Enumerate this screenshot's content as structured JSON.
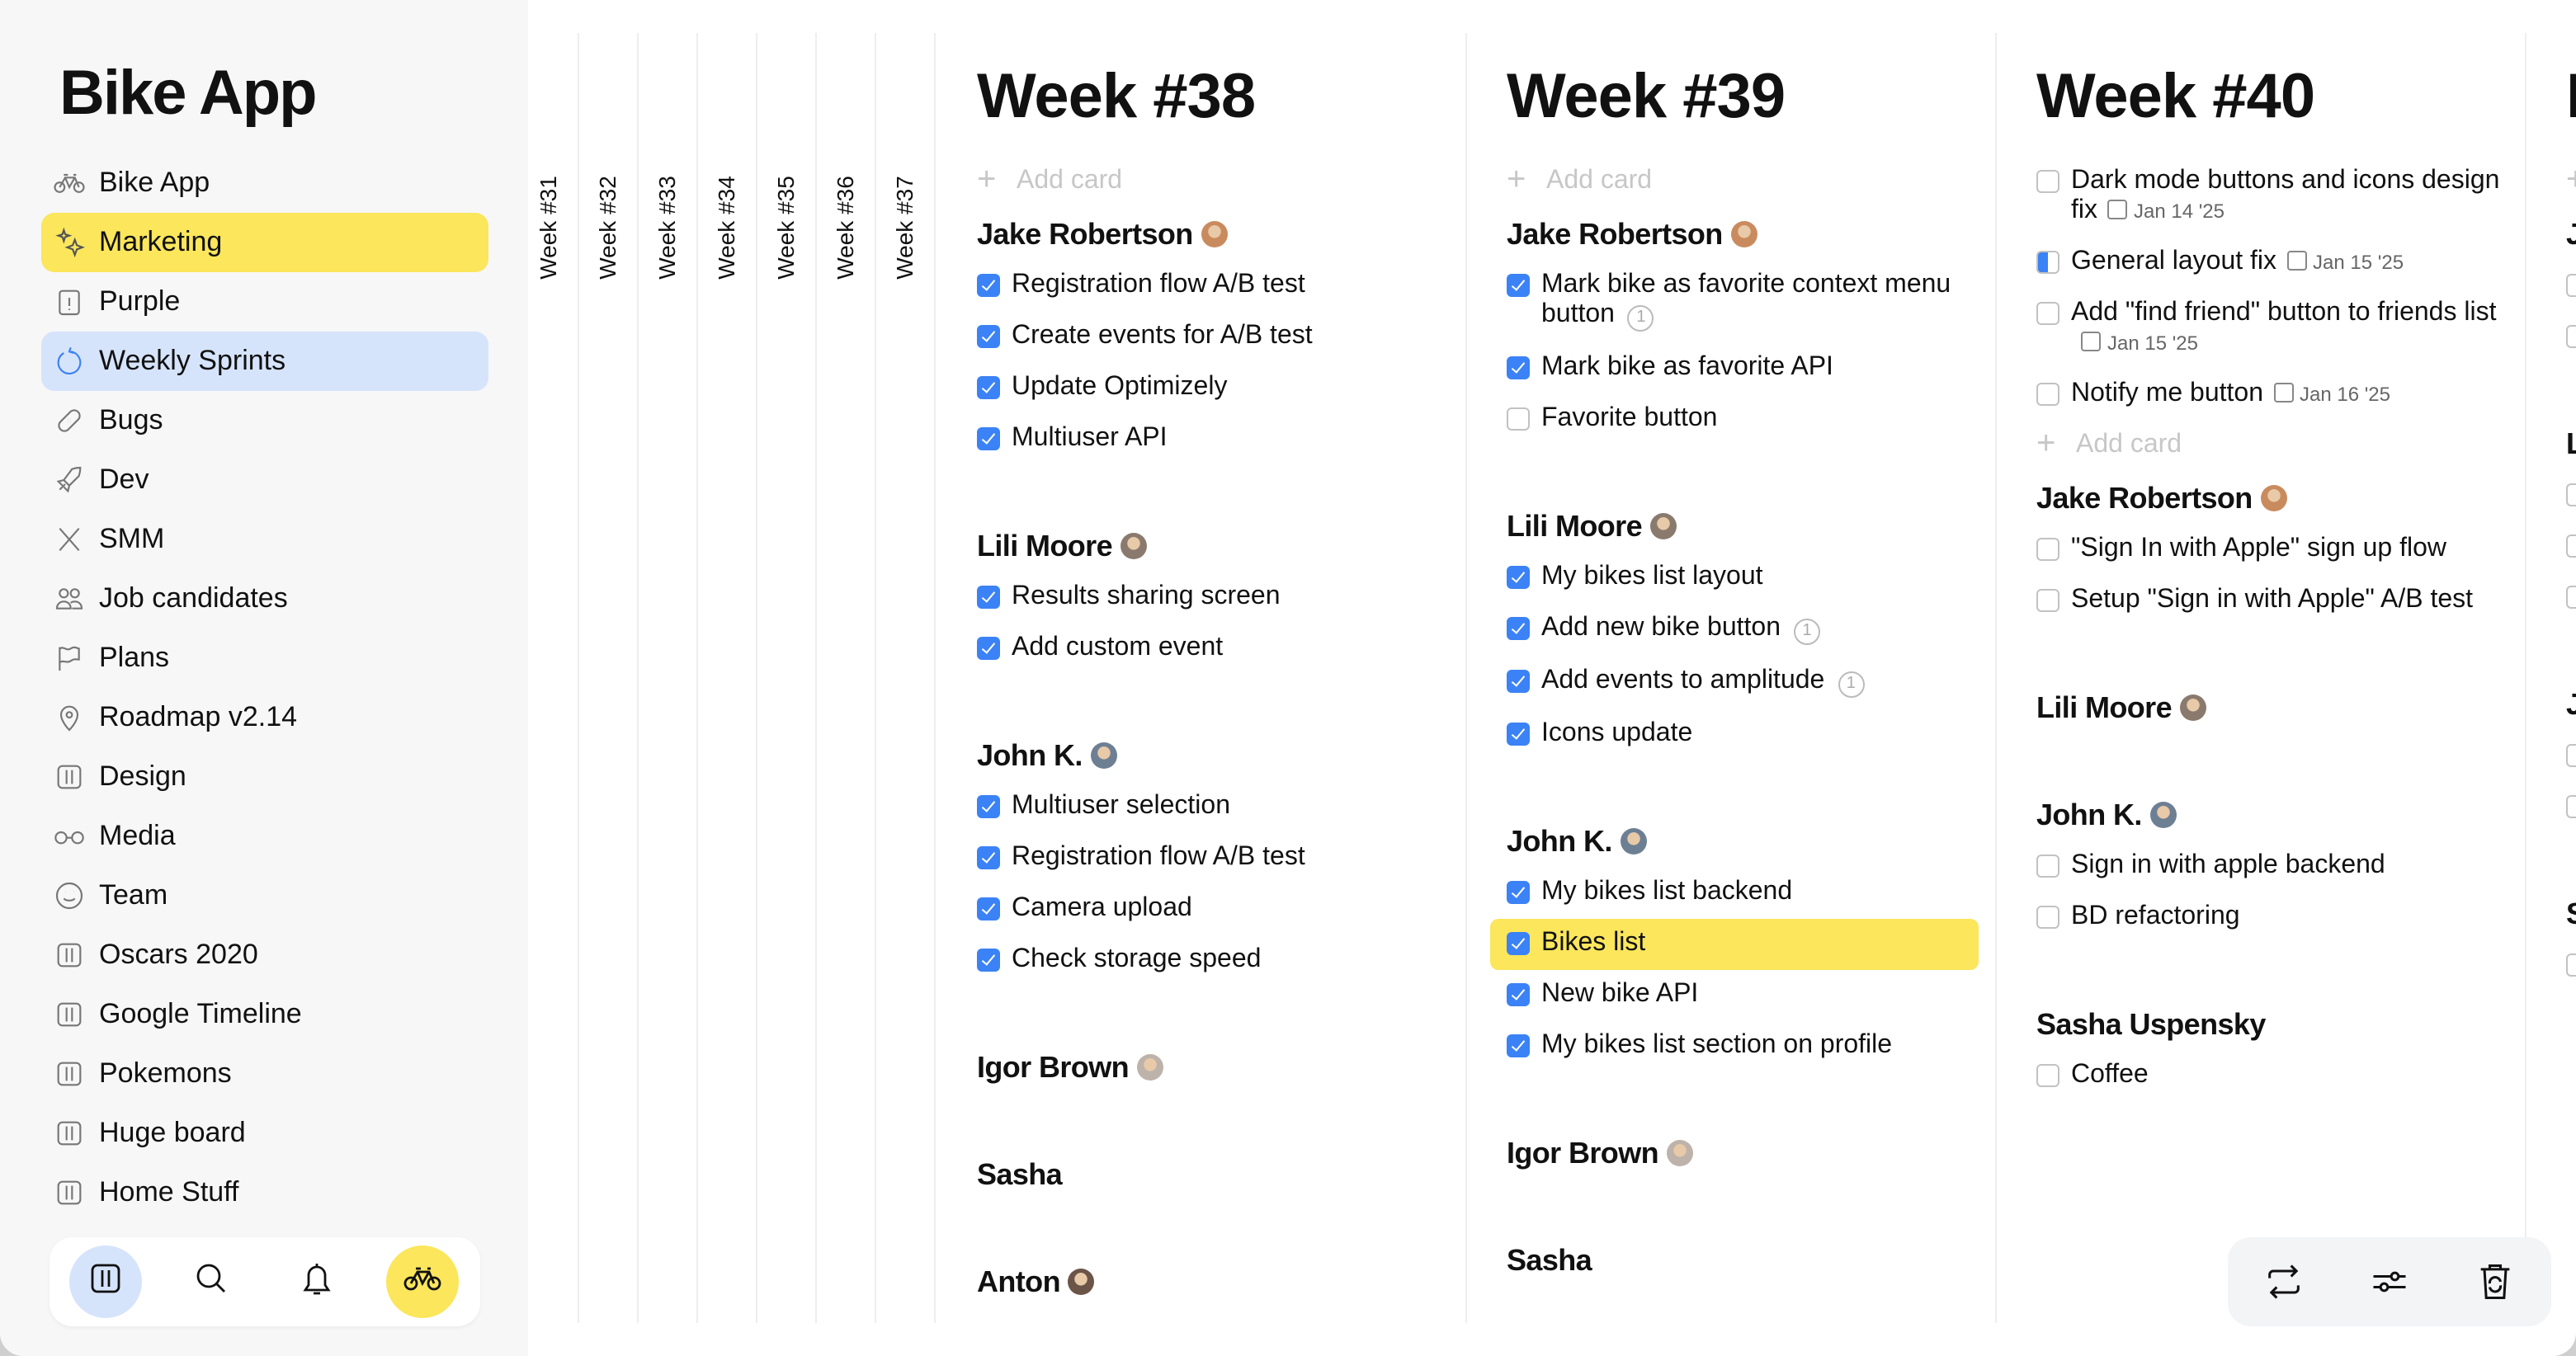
{
  "sidebar": {
    "title": "Bike App",
    "items": [
      {
        "label": "Bike App",
        "icon": "bike-icon",
        "state": ""
      },
      {
        "label": "Marketing",
        "icon": "sparkles-icon",
        "state": "yellow"
      },
      {
        "label": "Purple",
        "icon": "clipboard-alert-icon",
        "state": ""
      },
      {
        "label": "Weekly Sprints",
        "icon": "refresh-icon",
        "state": "blue"
      },
      {
        "label": "Bugs",
        "icon": "bandage-icon",
        "state": ""
      },
      {
        "label": "Dev",
        "icon": "rocket-icon",
        "state": ""
      },
      {
        "label": "SMM",
        "icon": "x-logo-icon",
        "state": ""
      },
      {
        "label": "Job candidates",
        "icon": "users-icon",
        "state": ""
      },
      {
        "label": "Plans",
        "icon": "flag-icon",
        "state": ""
      },
      {
        "label": "Roadmap v2.14",
        "icon": "map-pin-icon",
        "state": ""
      },
      {
        "label": "Design",
        "icon": "board-icon",
        "state": ""
      },
      {
        "label": "Media",
        "icon": "glasses-icon",
        "state": ""
      },
      {
        "label": "Team",
        "icon": "smile-icon",
        "state": ""
      },
      {
        "label": "Oscars 2020",
        "icon": "board-icon",
        "state": ""
      },
      {
        "label": "Google Timeline",
        "icon": "board-icon",
        "state": ""
      },
      {
        "label": "Pokemons",
        "icon": "board-icon",
        "state": ""
      },
      {
        "label": "Huge board",
        "icon": "board-icon",
        "state": ""
      },
      {
        "label": "Home Stuff",
        "icon": "board-icon",
        "state": ""
      }
    ],
    "bottom_nav": [
      {
        "icon": "board-icon",
        "active": true,
        "color": "#d6e4fb"
      },
      {
        "icon": "search-icon",
        "active": false
      },
      {
        "icon": "bell-icon",
        "active": false
      },
      {
        "icon": "bike-icon",
        "active": false,
        "color": "#fbe65c"
      }
    ]
  },
  "collapsed_weeks": [
    "Week #31",
    "Week #32",
    "Week #33",
    "Week #34",
    "Week #35",
    "Week #36",
    "Week #37"
  ],
  "add_card_label": "Add card",
  "weeks": [
    {
      "title": "Week #38",
      "add_card_position": "top",
      "ungrouped": [],
      "groups": [
        {
          "name": "Jake Robertson",
          "avatar": "#c98b5e",
          "items": [
            {
              "text": "Registration flow A/B test",
              "state": "checked"
            },
            {
              "text": "Create events for A/B test",
              "state": "checked"
            },
            {
              "text": "Update Optimizely",
              "state": "checked"
            },
            {
              "text": "Multiuser API",
              "state": "checked"
            }
          ]
        },
        {
          "name": "Lili Moore",
          "avatar": "#8a7a6e",
          "items": [
            {
              "text": "Results sharing screen",
              "state": "checked"
            },
            {
              "text": "Add custom event",
              "state": "checked"
            }
          ]
        },
        {
          "name": "John K.",
          "avatar": "#6d7f93",
          "items": [
            {
              "text": "Multiuser selection",
              "state": "checked"
            },
            {
              "text": "Registration flow A/B test",
              "state": "checked"
            },
            {
              "text": "Camera upload",
              "state": "checked"
            },
            {
              "text": "Check storage speed",
              "state": "checked"
            }
          ]
        },
        {
          "name": "Igor Brown",
          "avatar": "#bdb3aa",
          "items": []
        },
        {
          "name": "Sasha",
          "avatar": "",
          "items": []
        },
        {
          "name": "Anton",
          "avatar": "#6b5448",
          "items": []
        }
      ]
    },
    {
      "title": "Week #39",
      "add_card_position": "top",
      "ungrouped": [],
      "groups": [
        {
          "name": "Jake Robertson",
          "avatar": "#c98b5e",
          "items": [
            {
              "text": "Mark bike as favorite context menu button",
              "state": "checked",
              "comments": "1"
            },
            {
              "text": "Mark bike as favorite API",
              "state": "checked"
            },
            {
              "text": "Favorite button",
              "state": "unchecked"
            }
          ]
        },
        {
          "name": "Lili Moore",
          "avatar": "#8a7a6e",
          "items": [
            {
              "text": "My bikes list layout",
              "state": "checked"
            },
            {
              "text": "Add new bike button",
              "state": "checked",
              "comments": "1"
            },
            {
              "text": "Add events to amplitude",
              "state": "checked",
              "comments": "1"
            },
            {
              "text": "Icons update",
              "state": "checked"
            }
          ]
        },
        {
          "name": "John K.",
          "avatar": "#6d7f93",
          "items": [
            {
              "text": "My bikes list backend",
              "state": "checked"
            },
            {
              "text": "Bikes list",
              "state": "checked",
              "highlighted": true
            },
            {
              "text": "New bike API",
              "state": "checked"
            },
            {
              "text": "My bikes list section on profile",
              "state": "checked"
            }
          ]
        },
        {
          "name": "Igor Brown",
          "avatar": "#bdb3aa",
          "items": []
        },
        {
          "name": "Sasha",
          "avatar": "",
          "items": []
        }
      ]
    },
    {
      "title": "Week #40",
      "add_card_position": "after-ungrouped",
      "ungrouped": [
        {
          "text": "Dark mode buttons and icons design fix",
          "state": "unchecked",
          "date": "Jan 14 '25"
        },
        {
          "text": "General layout fix",
          "state": "partial",
          "date": "Jan 15 '25"
        },
        {
          "text": "Add \"find friend\" button to friends list",
          "state": "unchecked",
          "date": "Jan 15 '25"
        },
        {
          "text": "Notify me button",
          "state": "unchecked",
          "date": "Jan 16 '25"
        }
      ],
      "groups": [
        {
          "name": "Jake Robertson",
          "avatar": "#c98b5e",
          "items": [
            {
              "text": "\"Sign In with Apple\" sign up flow",
              "state": "unchecked"
            },
            {
              "text": "Setup \"Sign in with Apple\" A/B test",
              "state": "unchecked"
            }
          ]
        },
        {
          "name": "Lili Moore",
          "avatar": "#8a7a6e",
          "items": []
        },
        {
          "name": "John K.",
          "avatar": "#6d7f93",
          "items": [
            {
              "text": "Sign in with apple backend",
              "state": "unchecked"
            },
            {
              "text": "BD refactoring",
              "state": "unchecked"
            }
          ]
        },
        {
          "name": "Sasha Uspensky",
          "avatar": "",
          "items": [
            {
              "text": "Coffee",
              "state": "unchecked"
            }
          ]
        }
      ]
    }
  ],
  "partial_week": {
    "title": "N",
    "headers": [
      "J",
      "L",
      "J",
      "S"
    ]
  },
  "right_toolbar": [
    {
      "icon": "sync-icon"
    },
    {
      "icon": "sliders-icon"
    },
    {
      "icon": "trash-restore-icon"
    }
  ],
  "colors": {
    "accent": "#3b82f6",
    "highlight": "#fbe65c",
    "selected": "#d6e4fb"
  }
}
